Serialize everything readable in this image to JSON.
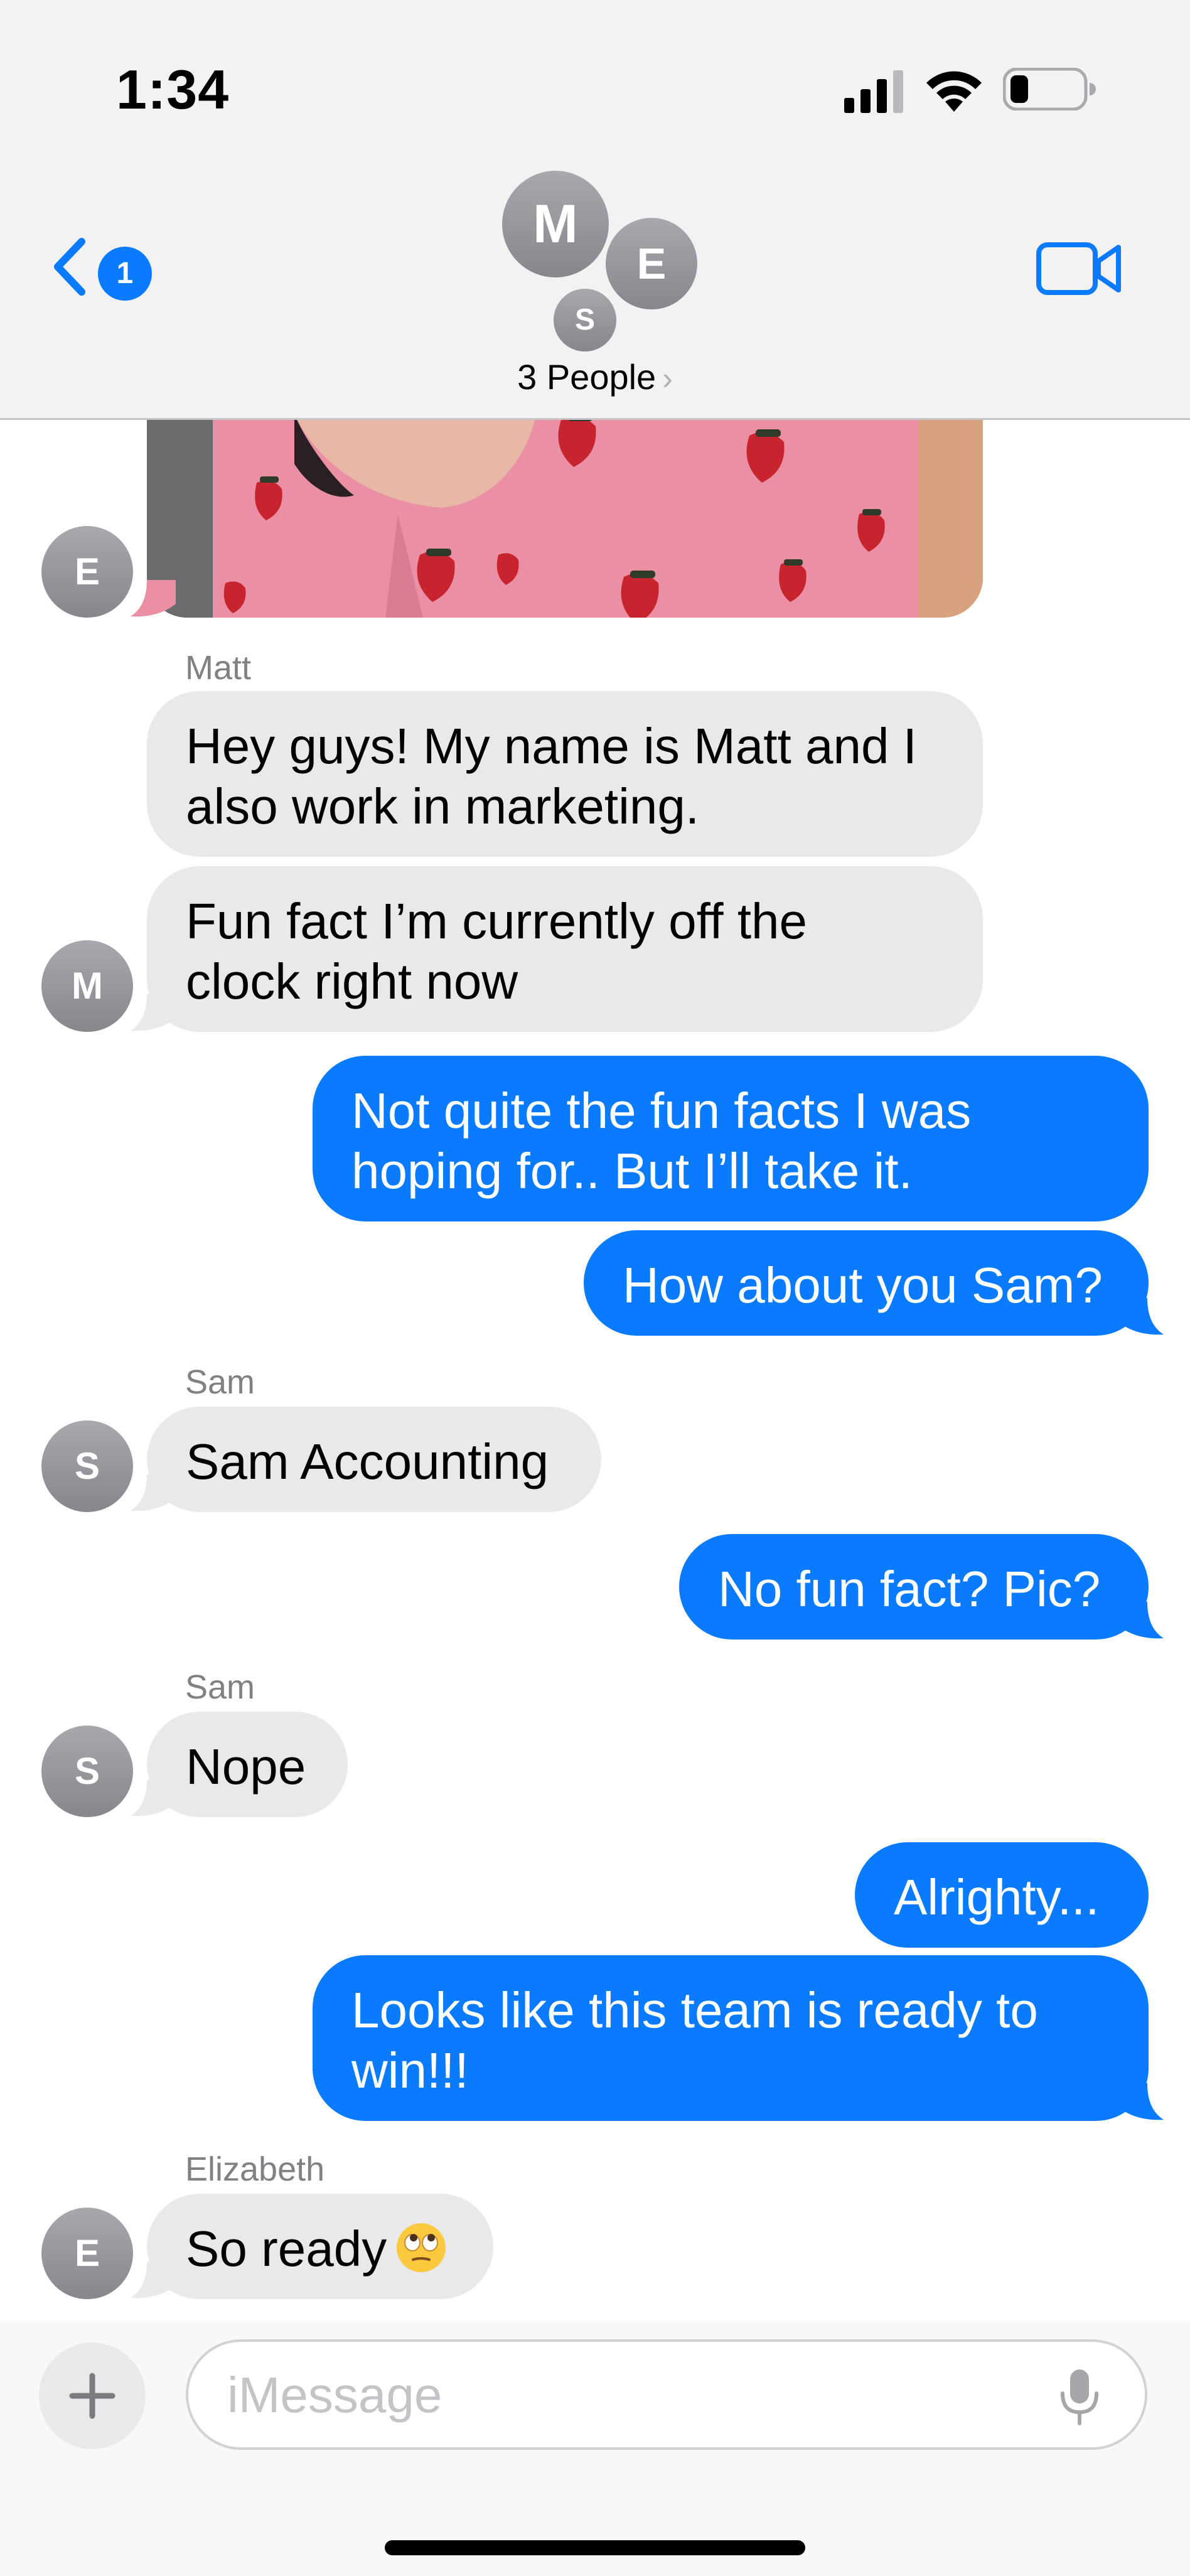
{
  "status_bar": {
    "time": "1:34"
  },
  "header": {
    "unread_count": "1",
    "group_name": "3 People",
    "avatars": [
      "M",
      "E",
      "S"
    ]
  },
  "colors": {
    "accent": "#0a7aff",
    "incoming_bubble": "#e9e9eb",
    "sender_name": "#808085"
  },
  "messages": [
    {
      "type": "photo",
      "from": "Elizabeth",
      "avatar": "E"
    },
    {
      "from": "Matt",
      "sender_label": "Matt",
      "text_lines": [
        "Hey guys! My name is Matt and I",
        "also work in marketing."
      ]
    },
    {
      "from": "Matt",
      "avatar": "M",
      "text_lines": [
        "Fun fact I’m currently off the",
        "clock right now"
      ]
    },
    {
      "from": "me",
      "text_lines": [
        "Not quite the fun facts I was",
        "hoping for.. But I’ll take it."
      ]
    },
    {
      "from": "me",
      "text_lines": [
        "How about you Sam?"
      ]
    },
    {
      "from": "Sam",
      "sender_label": "Sam",
      "avatar": "S",
      "text_lines": [
        "Sam Accounting"
      ]
    },
    {
      "from": "me",
      "text_lines": [
        "No fun fact? Pic?"
      ]
    },
    {
      "from": "Sam",
      "sender_label": "Sam",
      "avatar": "S",
      "text_lines": [
        "Nope"
      ]
    },
    {
      "from": "me",
      "text_lines": [
        "Alrighty..."
      ]
    },
    {
      "from": "me",
      "text_lines": [
        "Looks like this team is ready to",
        "win!!!"
      ]
    },
    {
      "from": "Elizabeth",
      "sender_label": "Elizabeth",
      "avatar": "E",
      "text_lines": [
        "So ready"
      ],
      "emoji": "eye-roll-emoji"
    }
  ],
  "input": {
    "placeholder": "iMessage",
    "value": ""
  },
  "icons": {
    "back": "chevron-left-icon",
    "video": "video-camera-icon",
    "plus": "plus-icon",
    "mic": "microphone-icon",
    "signal": "cellular-signal-icon",
    "wifi": "wifi-icon",
    "battery": "battery-icon"
  }
}
